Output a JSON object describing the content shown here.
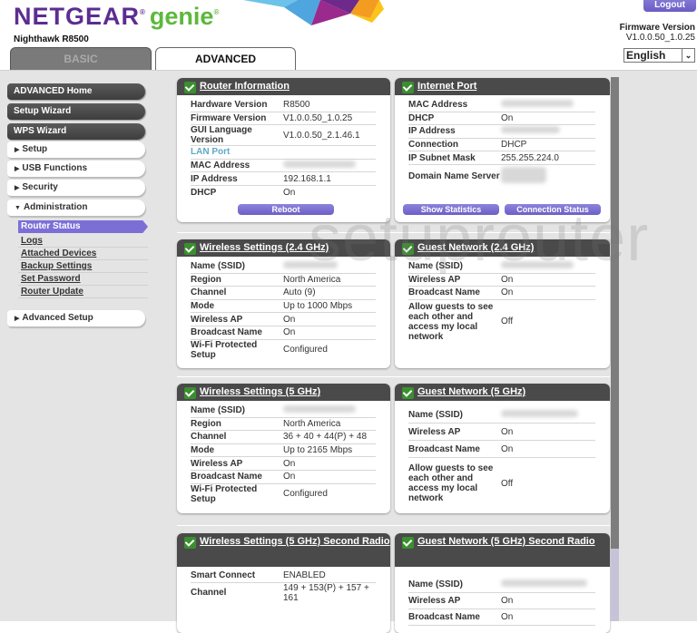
{
  "header": {
    "brand": "NETGEAR",
    "brand_suffix": "genie",
    "model": "Nighthawk R8500",
    "tabs": [
      {
        "label": "BASIC",
        "active": false
      },
      {
        "label": "ADVANCED",
        "active": true
      }
    ],
    "logout_label": "Logout",
    "firmware_label": "Firmware Version",
    "firmware_value": "V1.0.0.50_1.0.25",
    "language": "English"
  },
  "sidebar": {
    "top_buttons": [
      "ADVANCED Home",
      "Setup Wizard",
      "WPS Wizard"
    ],
    "sections": [
      "Setup",
      "USB Functions",
      "Security",
      "Administration"
    ],
    "admin_items": [
      "Router Status",
      "Logs",
      "Attached Devices",
      "Backup Settings",
      "Set Password",
      "Router Update"
    ],
    "active_item": "Router Status",
    "advanced_setup": "Advanced Setup"
  },
  "watermark": "setuprouter",
  "panels": {
    "router_info": {
      "title": "Router Information",
      "rows": [
        {
          "k": "Hardware Version",
          "v": "R8500"
        },
        {
          "k": "Firmware Version",
          "v": "V1.0.0.50_1.0.25"
        },
        {
          "k": "GUI Language Version",
          "v": "V1.0.0.50_2.1.46.1"
        },
        {
          "k": "LAN Port",
          "v": ""
        },
        {
          "k": "MAC Address",
          "v": ""
        },
        {
          "k": "IP Address",
          "v": "192.168.1.1"
        },
        {
          "k": "DHCP",
          "v": "On"
        }
      ],
      "button": "Reboot"
    },
    "internet_port": {
      "title": "Internet Port",
      "rows": [
        {
          "k": "MAC Address",
          "v": ""
        },
        {
          "k": "DHCP",
          "v": "On"
        },
        {
          "k": "IP Address",
          "v": ""
        },
        {
          "k": "Connection",
          "v": "DHCP"
        },
        {
          "k": "IP Subnet Mask",
          "v": "255.255.224.0"
        },
        {
          "k": "Domain Name Server",
          "v": ""
        }
      ],
      "buttons": [
        "Show Statistics",
        "Connection Status"
      ]
    },
    "wireless_24": {
      "title": "Wireless Settings (2.4 GHz)",
      "rows": [
        {
          "k": "Name (SSID)",
          "v": ""
        },
        {
          "k": "Region",
          "v": "North America"
        },
        {
          "k": "Channel",
          "v": "Auto (9)"
        },
        {
          "k": "Mode",
          "v": "Up to 1000 Mbps"
        },
        {
          "k": "Wireless AP",
          "v": "On"
        },
        {
          "k": "Broadcast Name",
          "v": "On"
        },
        {
          "k": "Wi-Fi Protected Setup",
          "v": "Configured"
        }
      ]
    },
    "guest_24": {
      "title": "Guest Network (2.4 GHz)",
      "rows": [
        {
          "k": "Name (SSID)",
          "v": ""
        },
        {
          "k": "Wireless AP",
          "v": "On"
        },
        {
          "k": "Broadcast Name",
          "v": "On"
        },
        {
          "k": "Allow guests to see each other and access my local network",
          "v": "Off"
        }
      ]
    },
    "wireless_5": {
      "title": "Wireless Settings (5 GHz)",
      "rows": [
        {
          "k": "Name (SSID)",
          "v": ""
        },
        {
          "k": "Region",
          "v": "North America"
        },
        {
          "k": "Channel",
          "v": "36 + 40 + 44(P) + 48"
        },
        {
          "k": "Mode",
          "v": "Up to 2165 Mbps"
        },
        {
          "k": "Wireless AP",
          "v": "On"
        },
        {
          "k": "Broadcast Name",
          "v": "On"
        },
        {
          "k": "Wi-Fi Protected Setup",
          "v": "Configured"
        }
      ]
    },
    "guest_5": {
      "title": "Guest Network (5 GHz)",
      "rows": [
        {
          "k": "Name (SSID)",
          "v": ""
        },
        {
          "k": "Wireless AP",
          "v": "On"
        },
        {
          "k": "Broadcast Name",
          "v": "On"
        },
        {
          "k": "Allow guests to see each other and access my local network",
          "v": "Off"
        }
      ]
    },
    "wireless_5_2": {
      "title": "Wireless Settings (5 GHz) Second Radio",
      "rows": [
        {
          "k": "Smart Connect",
          "v": "ENABLED"
        },
        {
          "k": "Channel",
          "v": "149 + 153(P) + 157 + 161"
        }
      ]
    },
    "guest_5_2": {
      "title": "Guest Network (5 GHz) Second Radio",
      "rows": [
        {
          "k": "Name (SSID)",
          "v": ""
        },
        {
          "k": "Wireless AP",
          "v": "On"
        },
        {
          "k": "Broadcast Name",
          "v": "On"
        }
      ]
    }
  }
}
